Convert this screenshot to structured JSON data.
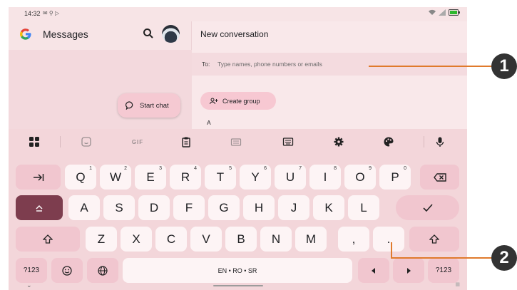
{
  "status_bar": {
    "time": "14:32"
  },
  "left_pane": {
    "app_title": "Messages",
    "start_chat_label": "Start chat"
  },
  "right_pane": {
    "title": "New conversation",
    "to_label": "To:",
    "to_placeholder": "Type names, phone numbers or emails",
    "create_group_label": "Create group",
    "section_letter": "A"
  },
  "keyboard": {
    "toolbar": {
      "gif_label": "GIF"
    },
    "row1": [
      {
        "label": "Q",
        "sup": "1"
      },
      {
        "label": "W",
        "sup": "2"
      },
      {
        "label": "E",
        "sup": "3"
      },
      {
        "label": "R",
        "sup": "4"
      },
      {
        "label": "T",
        "sup": "5"
      },
      {
        "label": "Y",
        "sup": "6"
      },
      {
        "label": "U",
        "sup": "7"
      },
      {
        "label": "I",
        "sup": "8"
      },
      {
        "label": "O",
        "sup": "9"
      },
      {
        "label": "P",
        "sup": "0"
      }
    ],
    "row2": [
      "A",
      "S",
      "D",
      "F",
      "G",
      "H",
      "J",
      "K",
      "L"
    ],
    "row3": [
      "Z",
      "X",
      "C",
      "V",
      "B",
      "N",
      "M",
      ",",
      "."
    ],
    "symbols_label": "?123",
    "symbols_label_right": "?123",
    "space_label": "EN • RO • SR"
  },
  "callouts": {
    "one": "1",
    "two": "2"
  },
  "colors": {
    "accent": "#7d3d4e",
    "callout_line": "#e07a2c",
    "background": "#f7e4e6"
  }
}
